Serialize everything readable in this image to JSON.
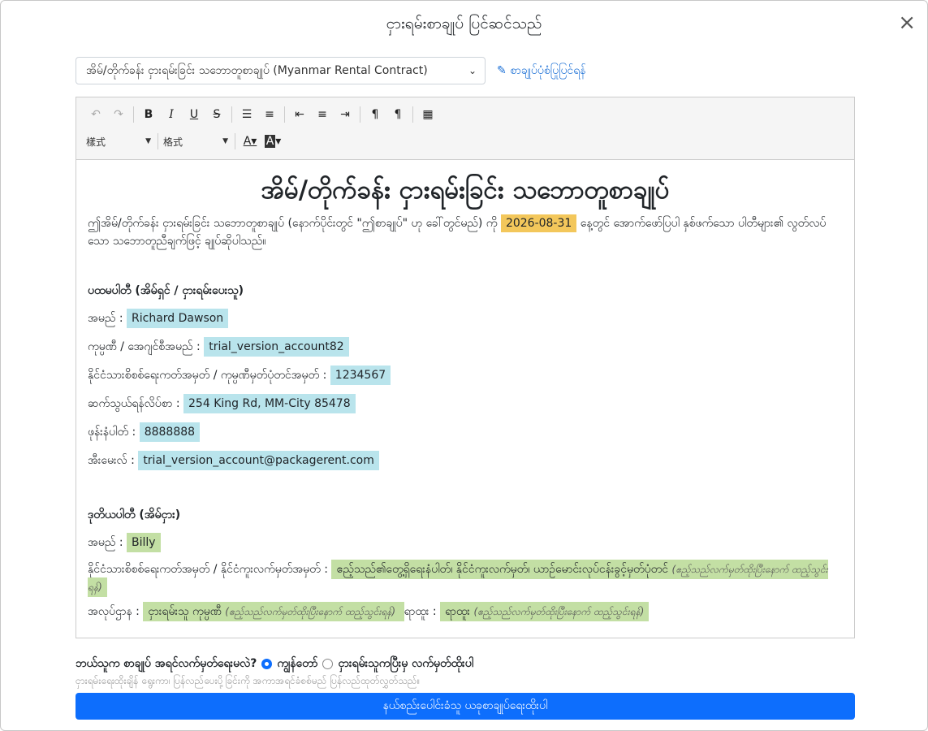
{
  "modal": {
    "title": "ငှားရမ်းစာချုပ် ပြင်ဆင်သည်",
    "close_glyph": "×"
  },
  "template": {
    "selected": "အိမ်/တိုက်ခန်း ငှားရမ်းခြင်း သဘောတူစာချုပ် (Myanmar Rental Contract)",
    "edit_link": "စာချုပ်ပုံစံပြုပြင်ရန်"
  },
  "toolbar": {
    "style_label": "樣式",
    "format_label": "格式"
  },
  "doc": {
    "title": "အိမ်/တိုက်ခန်း ငှားရမ်းခြင်း သဘောတူစာချုပ်",
    "intro_before": "ဤအိမ်/တိုက်ခန်း ငှားရမ်းခြင်း သဘောတူစာချုပ် (နောက်ပိုင်းတွင် \"ဤစာချုပ်\" ဟု ခေါ်တွင်မည်) ကို",
    "date": "2026-08-31",
    "intro_after": "နေ့တွင် အောက်ဖော်ပြပါ နှစ်ဖက်သော ပါတီများ၏ လွတ်လပ်သော သဘောတူညီချက်ဖြင့် ချုပ်ဆိုပါသည်။",
    "party1": {
      "heading": "ပထမပါတီ (အိမ်ရှင် / ငှားရမ်းပေးသူ)",
      "name_label": "အမည် :",
      "name": "Richard Dawson",
      "company_label": "ကုမ္ပဏီ / အေဂျင်စီအမည် :",
      "company": "trial_version_account82",
      "id_label": "နိုင်ငံသားစိစစ်ရေးကတ်အမှတ် / ကုမ္ပဏီမှတ်ပုံတင်အမှတ် :",
      "id": "1234567",
      "address_label": "ဆက်သွယ်ရန်လိပ်စာ :",
      "address": "254 King Rd, MM-City 85478",
      "phone_label": "ဖုန်းနံပါတ် :",
      "phone": "8888888",
      "email_label": "အီးမေးလ် :",
      "email": "trial_version_account@packagerent.com"
    },
    "party2": {
      "heading": "ဒုတိယပါတီ (အိမ်ငှား)",
      "name_label": "အမည် :",
      "name": "Billy",
      "id_label": "နိုင်ငံသားစိစစ်ရေးကတ်အမှတ် / နိုင်ငံကူးလက်မှတ်အမှတ် :",
      "id_value": "ဧည့်သည်၏တွေ့ရှိရေးနံပါတ်၊ နိုင်ငံကူးလက်မှတ်၊ ယာဉ်မောင်းလုပ်ငန်းခွင့်မှတ်ပုံတင်",
      "id_note": "(ဧည့်သည်လက်မှတ်ထိုးပြီးနောက် ထည့်သွင်းရန်)",
      "job_label": "အလုပ်ဌာန :",
      "job_value": "ငှားရမ်းသူ ကုမ္ပဏီ",
      "job_note": "(ဧည့်သည်လက်မှတ်ထိုးပြီးနောက် ထည့်သွင်းရန်)",
      "title_label": "ရာထူး :",
      "title_value": "ရာထူး",
      "title_note": "(ဧည့်သည်လက်မှတ်ထိုးပြီးနောက် ထည့်သွင်းရန်)"
    }
  },
  "signer": {
    "question": "ဘယ်သူက စာချုပ် အရင်လက်မှတ်ရေးမလဲ?",
    "option_me": "ကျွန်တော်",
    "option_tenant": "ငှားရမ်းသူကပြီးမှ လက်မှတ်ထိုးပါ",
    "helper": "ငှားရမ်းရေးထိုးချိန် ရွေးကာ၊ ပြန်လည်ပေးပို့ခြင်းကို အကာအရင်ခံစစ်မည် ပြန်လည်ထုတ်လွှတ်သည်။"
  },
  "submit_label": "နယ်စည်းပေါင်းခံသူ ယခုစာချုပ်ရေးထိုးပါ"
}
